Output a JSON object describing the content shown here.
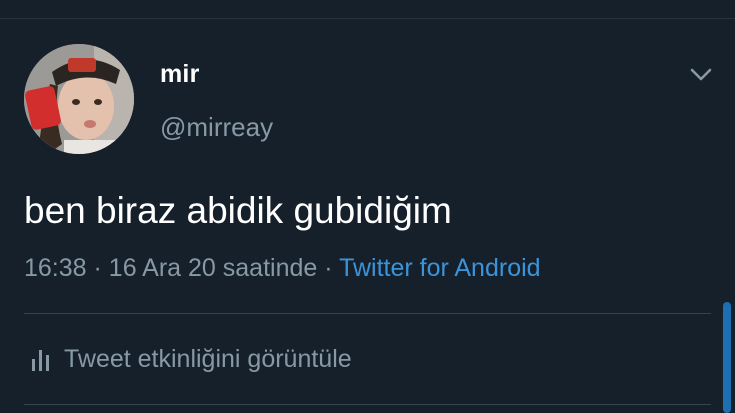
{
  "tweet": {
    "display_name": "mir",
    "handle": "@mirreay",
    "text": "ben biraz abidik gubidiğim",
    "time": "16:38",
    "date_suffix": "16 Ara 20 saatinde",
    "separator": "·",
    "source": "Twitter for Android"
  },
  "actions": {
    "view_activity_label": "Tweet etkinliğini görüntüle"
  },
  "icons": {
    "menu": "chevron-down-icon",
    "activity": "bar-chart-icon"
  },
  "colors": {
    "background": "#15202b",
    "primary_text": "#ffffff",
    "secondary_text": "#8899a6",
    "link": "#3b94d9"
  }
}
